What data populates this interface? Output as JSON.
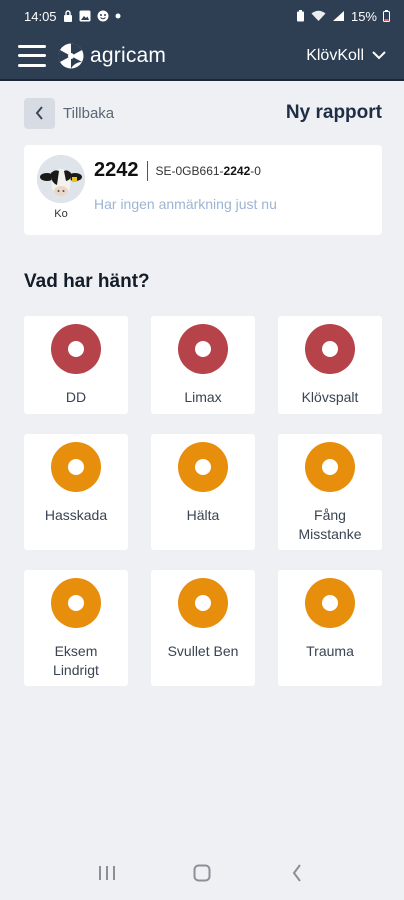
{
  "status_bar": {
    "time": "14:05",
    "battery": "15%",
    "icons": [
      "lock-icon",
      "image-icon",
      "face-icon",
      "dot-icon",
      "battery-saver-icon",
      "wifi-icon",
      "signal-icon"
    ]
  },
  "app_bar": {
    "brand": "agricam",
    "farm_name": "KlövKoll"
  },
  "back": {
    "label": "Tillbaka"
  },
  "page_title": "Ny rapport",
  "animal": {
    "number": "2242",
    "ear_tag_prefix": "SE-0GB661-",
    "ear_tag_bold": "2242",
    "ear_tag_suffix": "-0",
    "type_label": "Ko",
    "remark": "Har ingen anmärkning just nu"
  },
  "section_heading": "Vad har hänt?",
  "colors": {
    "severe": "#b7434a",
    "moderate": "#e88e0d",
    "header": "#2e3e53"
  },
  "events": [
    {
      "label": "DD",
      "severity": "severe"
    },
    {
      "label": "Limax",
      "severity": "severe"
    },
    {
      "label": "Klövspalt",
      "severity": "severe"
    },
    {
      "label": "Hasskada",
      "severity": "moderate"
    },
    {
      "label": "Hälta",
      "severity": "moderate"
    },
    {
      "label": "Fång Misstanke",
      "severity": "moderate"
    },
    {
      "label": "Eksem Lindrigt",
      "severity": "moderate"
    },
    {
      "label": "Svullet Ben",
      "severity": "moderate"
    },
    {
      "label": "Trauma",
      "severity": "moderate"
    }
  ]
}
